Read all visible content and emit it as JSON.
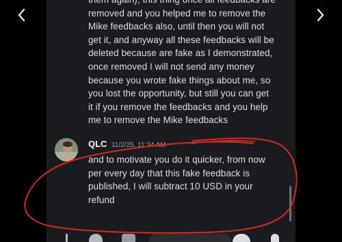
{
  "nav": {
    "prev_icon": "chevron-left-icon",
    "next_icon": "chevron-right-icon"
  },
  "previous_message": {
    "lines": [
      "them again), this thing once all feedbacks are",
      "removed and you helped me to remove the",
      "Mike feedbacks also, until then you will not",
      "get it, and anyway all these feedbacks will be",
      "deleted because are fake as I demonstrated,",
      "once removed I will not send any money",
      "because you wrote fake things about me, so",
      "you lost the opportunity, but still you can get",
      "it if you remove the feedbacks and you help",
      "me to remove the Mike feedbacks"
    ]
  },
  "qlc_message": {
    "author": "QLC",
    "timestamp": "11/2/25, 11:34 AM",
    "lines": [
      "and to motivate you do it quicker, from now",
      "per every day that this fake feedback is",
      "published, I will subtract 10 USD in your",
      "refund"
    ]
  },
  "toolbar": {
    "icons": [
      "plus-icon",
      "apps-icon",
      "gift-icon",
      "message-input",
      "emoji-icon",
      "mic-icon"
    ]
  },
  "colors": {
    "background": "#000000",
    "panel": "#1b1c20",
    "text": "#dbdee1",
    "timestamp": "#949ba4",
    "annotation": "#d8281a"
  }
}
